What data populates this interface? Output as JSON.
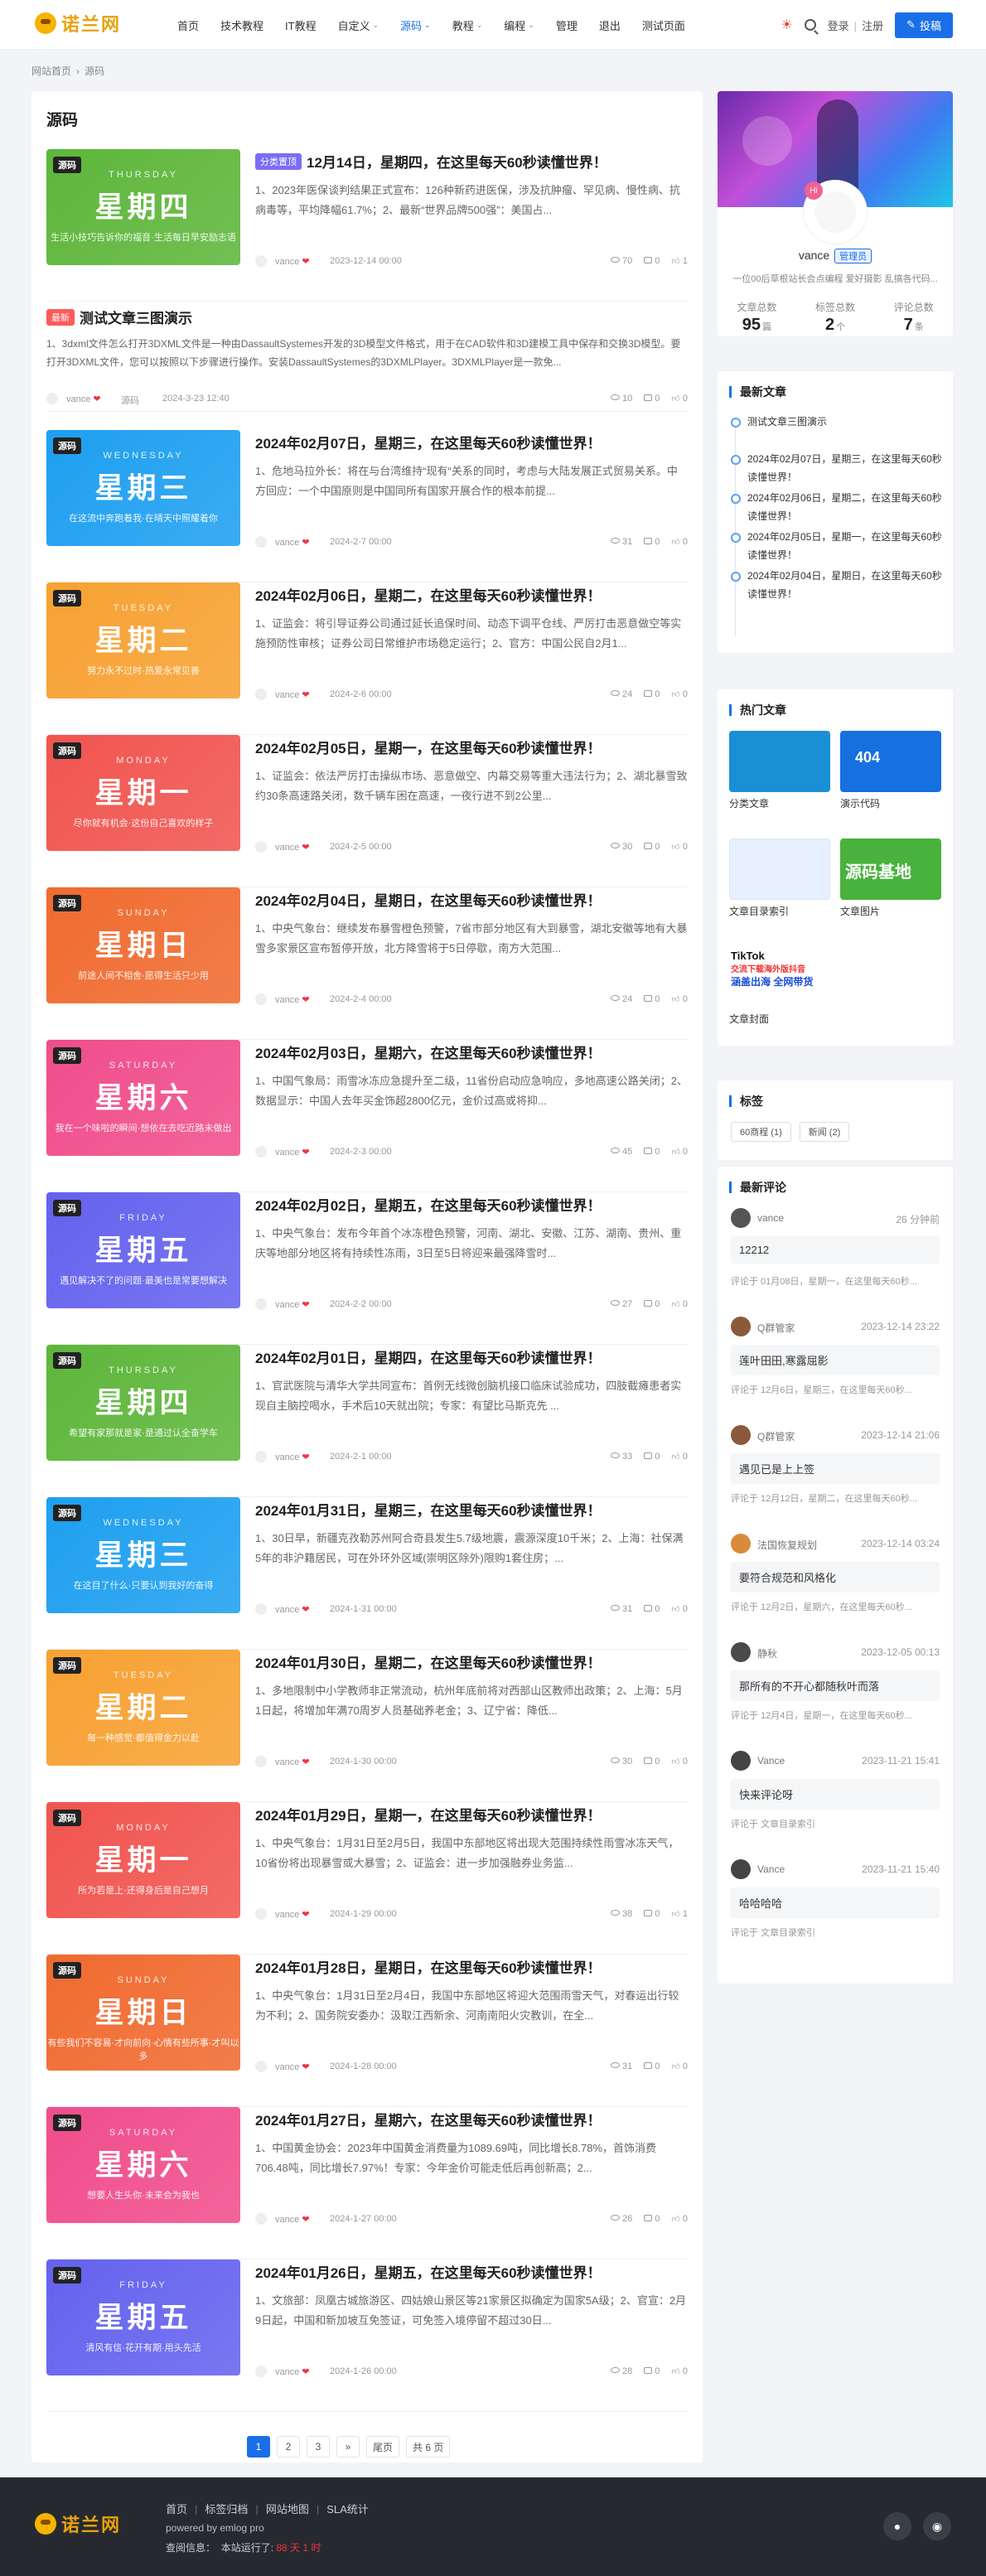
{
  "header": {
    "logo": "诺兰网",
    "nav": [
      {
        "label": "首页",
        "active": false,
        "dropdown": false
      },
      {
        "label": "技术教程",
        "active": false,
        "dropdown": false
      },
      {
        "label": "IT教程",
        "active": false,
        "dropdown": false
      },
      {
        "label": "自定义",
        "active": false,
        "dropdown": true
      },
      {
        "label": "源码",
        "active": true,
        "dropdown": true
      },
      {
        "label": "教程",
        "active": false,
        "dropdown": true
      },
      {
        "label": "编程",
        "active": false,
        "dropdown": true
      },
      {
        "label": "管理",
        "active": false,
        "dropdown": false
      },
      {
        "label": "退出",
        "active": false,
        "dropdown": false
      },
      {
        "label": "测试页面",
        "active": false,
        "dropdown": false
      }
    ],
    "login": "登录",
    "register": "注册",
    "post_button": "投稿"
  },
  "breadcrumb": {
    "home": "网站首页",
    "current": "源码"
  },
  "main": {
    "title": "源码"
  },
  "articles": [
    {
      "kind": "thumb",
      "tag": "源码",
      "eng": "THURSDAY",
      "day": "星期四",
      "sub": "生活小技巧告诉你的福音·生活每日早安励志语",
      "color": "#5db63a",
      "badge": "分类置顶",
      "title": "12月14日，星期四，在这里每天60秒读懂世界！",
      "excerpt": "1、2023年医保谈判结果正式宣布：126种新药进医保，涉及抗肿瘤、罕见病、慢性病、抗病毒等，平均降幅61.7%；2、最新“世界品牌500强”：美国占...",
      "author": "vance",
      "date": "2023-12-14 00:00",
      "views": "70",
      "comments": "0",
      "likes": "1"
    },
    {
      "kind": "text",
      "badge": "最新",
      "title": "测试文章三图演示",
      "excerpt": "1、3dxml文件怎么打开3DXML文件是一种由DassaultSystemes开发的3D模型文件格式，用于在CAD软件和3D建模工具中保存和交换3D模型。要打开3DXML文件，您可以按照以下步骤进行操作。安装DassaultSystemes的3DXMLPlayer。3DXMLPlayer是一款免...",
      "author": "vance",
      "category": "源码",
      "date": "2024-3-23 12:40",
      "views": "10",
      "comments": "0",
      "likes": "0"
    },
    {
      "kind": "thumb",
      "tag": "源码",
      "eng": "WEDNESDAY",
      "day": "星期三",
      "sub": "在这流中奔跑着我·在晴天中照耀着你",
      "color": "#1d9ff0",
      "title": "2024年02月07日，星期三，在这里每天60秒读懂世界！",
      "excerpt": "1、危地马拉外长：将在与台湾维持“现有“关系的同时，考虑与大陆发展正式贸易关系。中方回应：一个中国原则是中国同所有国家开展合作的根本前提...",
      "author": "vance",
      "date": "2024-2-7 00:00",
      "views": "31",
      "comments": "0",
      "likes": "0"
    },
    {
      "kind": "thumb",
      "tag": "源码",
      "eng": "TUESDAY",
      "day": "星期二",
      "sub": "努力永不过时·热爱永常见善",
      "color": "#f7a131",
      "title": "2024年02月06日，星期二，在这里每天60秒读懂世界！",
      "excerpt": "1、证监会：将引导证券公司通过延长追保时间、动态下调平仓线、严厉打击恶意做空等实施预防性审核；证券公司日常维护市场稳定运行；2、官方：中国公民自2月1...",
      "author": "vance",
      "date": "2024-2-6 00:00",
      "views": "24",
      "comments": "0",
      "likes": "0"
    },
    {
      "kind": "thumb",
      "tag": "源码",
      "eng": "MONDAY",
      "day": "星期一",
      "sub": "尽你就有机会·这份自己喜欢的样子",
      "color": "#f1544f",
      "title": "2024年02月05日，星期一，在这里每天60秒读懂世界！",
      "excerpt": "1、证监会：依法严厉打击操纵市场、恶意做空、内幕交易等重大违法行为；2、湖北暴雪致约30条高速路关闭，数千辆车困在高速，一夜行进不到2公里...",
      "author": "vance",
      "date": "2024-2-5 00:00",
      "views": "30",
      "comments": "0",
      "likes": "0"
    },
    {
      "kind": "thumb",
      "tag": "源码",
      "eng": "SUNDAY",
      "day": "星期日",
      "sub": "前途人间不相舍·愿得生活只少用",
      "color": "#f06a2f",
      "title": "2024年02月04日，星期日，在这里每天60秒读懂世界！",
      "excerpt": "1、中央气象台：继续发布暴雪橙色预警，7省市部分地区有大到暴雪，湖北安徽等地有大暴雪多家景区宣布暂停开放，北方降雪将于5日停歇，南方大范围...",
      "author": "vance",
      "date": "2024-2-4 00:00",
      "views": "24",
      "comments": "0",
      "likes": "0"
    },
    {
      "kind": "thumb",
      "tag": "源码",
      "eng": "SATURDAY",
      "day": "星期六",
      "sub": "我在一个味啦的瞬间·想依在去吃近路未做出",
      "color": "#f04d8a",
      "title": "2024年02月03日，星期六，在这里每天60秒读懂世界！",
      "excerpt": "1、中国气象局：雨雪冰冻应急提升至二级，11省份启动应急响应，多地高速公路关闭；2、数据显示：中国人去年买金饰超2800亿元，金价过高或将抑...",
      "author": "vance",
      "date": "2024-2-3 00:00",
      "views": "45",
      "comments": "0",
      "likes": "0"
    },
    {
      "kind": "thumb",
      "tag": "源码",
      "eng": "FRIDAY",
      "day": "星期五",
      "sub": "遇见解决不了的问题·最美也是常要想解决",
      "color": "#6462ee",
      "title": "2024年02月02日，星期五，在这里每天60秒读懂世界！",
      "excerpt": "1、中央气象台：发布今年首个冰冻橙色预警，河南、湖北、安徽、江苏、湖南、贵州、重庆等地部分地区将有持续性冻雨，3日至5日将迎来最强降雪时...",
      "author": "vance",
      "date": "2024-2-2 00:00",
      "views": "27",
      "comments": "0",
      "likes": "0"
    },
    {
      "kind": "thumb",
      "tag": "源码",
      "eng": "THURSDAY",
      "day": "星期四",
      "sub": "希望有家那就是家·是通过认全奋学车",
      "color": "#5db63a",
      "title": "2024年02月01日，星期四，在这里每天60秒读懂世界！",
      "excerpt": "1、官武医院与清华大学共同宣布：首例无线微创脑机接口临床试验成功，四肢截瘫患者实现自主脑控喝水，手术后10天就出院；专家：有望比马斯克先 ...",
      "author": "vance",
      "date": "2024-2-1 00:00",
      "views": "33",
      "comments": "0",
      "likes": "0"
    },
    {
      "kind": "thumb",
      "tag": "源码",
      "eng": "WEDNESDAY",
      "day": "星期三",
      "sub": "在这目了什么·只要认到我好的奋得",
      "color": "#1d9ff0",
      "title": "2024年01月31日，星期三，在这里每天60秒读懂世界！",
      "excerpt": "1、30日早，新疆克孜勒苏州阿合奇县发生5.7级地震，震源深度10千米；2、上海：社保满5年的非沪籍居民，可在外环外区域(崇明区除外)限购1套住房；...",
      "author": "vance",
      "date": "2024-1-31 00:00",
      "views": "31",
      "comments": "0",
      "likes": "0"
    },
    {
      "kind": "thumb",
      "tag": "源码",
      "eng": "TUESDAY",
      "day": "星期二",
      "sub": "每一种感觉·都值得金力以赴",
      "color": "#f7a131",
      "title": "2024年01月30日，星期二，在这里每天60秒读懂世界！",
      "excerpt": "1、多地限制中小学教师非正常流动，杭州年底前将对西部山区教师出政策；2、上海：5月1日起，将增加年满70周岁人员基础养老金；3、辽宁省：降低...",
      "author": "vance",
      "date": "2024-1-30 00:00",
      "views": "30",
      "comments": "0",
      "likes": "0"
    },
    {
      "kind": "thumb",
      "tag": "源码",
      "eng": "MONDAY",
      "day": "星期一",
      "sub": "所为若是上·还得身后是自己想月",
      "color": "#f1544f",
      "title": "2024年01月29日，星期一，在这里每天60秒读懂世界！",
      "excerpt": "1、中央气象台：1月31日至2月5日，我国中东部地区将出现大范围持续性雨雪冰冻天气，10省份将出现暴雪或大暴雪；2、证监会：进一步加强融券业务监...",
      "author": "vance",
      "date": "2024-1-29 00:00",
      "views": "38",
      "comments": "0",
      "likes": "1"
    },
    {
      "kind": "thumb",
      "tag": "源码",
      "eng": "SUNDAY",
      "day": "星期日",
      "sub": "有些我们不容易·才向前向·心情有些所事·才叫以多",
      "color": "#f06a2f",
      "title": "2024年01月28日，星期日，在这里每天60秒读懂世界！",
      "excerpt": "1、中央气象台：1月31日至2月4日，我国中东部地区将迎大范围雨雪天气，对春运出行较为不利；2、国务院安委办：汲取江西新余、河南南阳火灾教训，在全...",
      "author": "vance",
      "date": "2024-1-28 00:00",
      "views": "31",
      "comments": "0",
      "likes": "0"
    },
    {
      "kind": "thumb",
      "tag": "源码",
      "eng": "SATURDAY",
      "day": "星期六",
      "sub": "想要人生头你·未来会为我也",
      "color": "#f04d8a",
      "title": "2024年01月27日，星期六，在这里每天60秒读懂世界！",
      "excerpt": "1、中国黄金协会：2023年中国黄金消费量为1089.69吨，同比增长8.78%，首饰消费706.48吨，同比增长7.97%！专家：今年金价可能走低后再创新高；2...",
      "author": "vance",
      "date": "2024-1-27 00:00",
      "views": "26",
      "comments": "0",
      "likes": "0"
    },
    {
      "kind": "thumb",
      "tag": "源码",
      "eng": "FRIDAY",
      "day": "星期五",
      "sub": "清风有信·花开有期·用头先活",
      "color": "#6462ee",
      "title": "2024年01月26日，星期五，在这里每天60秒读懂世界！",
      "excerpt": "1、文旅部：凤凰古城旅游区、四姑娘山景区等21家景区拟确定为国家5A级；2、官宣：2月9日起，中国和新加坡互免签证，可免签入境停留不超过30日...",
      "author": "vance",
      "date": "2024-1-26 00:00",
      "views": "28",
      "comments": "0",
      "likes": "0"
    }
  ],
  "pagination": {
    "pages": [
      "1",
      "2",
      "3",
      "»",
      "尾页"
    ],
    "current": "1",
    "total": "共 6 页"
  },
  "profile": {
    "name": "vance",
    "role": "管理员",
    "avatar_badge": "Hi",
    "desc": "一位00后草根站长会点编程 爱好摄影 乱搞各代码...",
    "stats": [
      {
        "label": "文章总数",
        "value": "95",
        "unit": "篇"
      },
      {
        "label": "标签总数",
        "value": "2",
        "unit": "个"
      },
      {
        "label": "评论总数",
        "value": "7",
        "unit": "条"
      }
    ]
  },
  "latest": {
    "title": "最新文章",
    "items": [
      "测试文章三图演示",
      "2024年02月07日，星期三，在这里每天60秒读懂世界！",
      "2024年02月06日，星期二，在这里每天60秒读懂世界！",
      "2024年02月05日，星期一，在这里每天60秒读懂世界！",
      "2024年02月04日，星期日，在这里每天60秒读懂世界！"
    ]
  },
  "hot": {
    "title": "热门文章",
    "items": [
      {
        "caption": "分类文章",
        "img_color": "#1b8fd6",
        "img_text": ""
      },
      {
        "caption": "演示代码",
        "img_color": "#1670e0",
        "img_text": "404"
      },
      {
        "caption": "文章目录索引",
        "img_color": "#e6f0ff",
        "img_text": ""
      },
      {
        "caption": "文章图片",
        "img_color": "#48b23c",
        "img_text": "源码基地"
      },
      {
        "caption": "文章封面",
        "img_color": "#ffffff",
        "img_text": "TikTok"
      }
    ],
    "tiktok_lines": [
      "交流下载海外版抖音",
      "涵盖出海 全网带货"
    ]
  },
  "tags": {
    "title": "标签",
    "items": [
      "60商程 (1)",
      "新闻 (2)"
    ]
  },
  "comments": {
    "title": "最新评论",
    "items": [
      {
        "name": "vance",
        "time": "26 分钟前",
        "text": "12212",
        "ref": "评论于 01月08日，星期一，在这里每天60秒...",
        "av": "#555"
      },
      {
        "name": "Q群管家",
        "time": "2023-12-14 23:22",
        "text": "莲叶田田,寒露屈影",
        "ref": "评论于 12月6日，星期三，在这里每天60秒...",
        "av": "#8a5a3a"
      },
      {
        "name": "Q群管家",
        "time": "2023-12-14 21:06",
        "text": "遇见已是上上签",
        "ref": "评论于 12月12日，星期二，在这里每天60秒...",
        "av": "#8a5a3a"
      },
      {
        "name": "法国恢复规划",
        "time": "2023-12-14 03:24",
        "text": "要符合规范和风格化",
        "ref": "评论于 12月2日，星期六，在这里每天60秒...",
        "av": "#d98a3a"
      },
      {
        "name": "静秋",
        "time": "2023-12-05 00:13",
        "text": "那所有的不开心都随秋叶而落",
        "ref": "评论于 12月4日，星期一，在这里每天60秒...",
        "av": "#4a4a4a"
      },
      {
        "name": "Vance",
        "time": "2023-11-21 15:41",
        "text": "快来评论呀",
        "ref": "评论于 文章目录索引",
        "av": "#444"
      },
      {
        "name": "Vance",
        "time": "2023-11-21 15:40",
        "text": "哈哈哈哈",
        "ref": "评论于 文章目录索引",
        "av": "#444"
      }
    ]
  },
  "footer": {
    "logo": "诺兰网",
    "links": [
      "首页",
      "标签归档",
      "网站地图",
      "SLA统计"
    ],
    "powered": "powered by emlog pro",
    "stat_label": "查阅信息：",
    "stat_prefix": "本站运行了:",
    "stat_value": "88 天 1 时"
  }
}
